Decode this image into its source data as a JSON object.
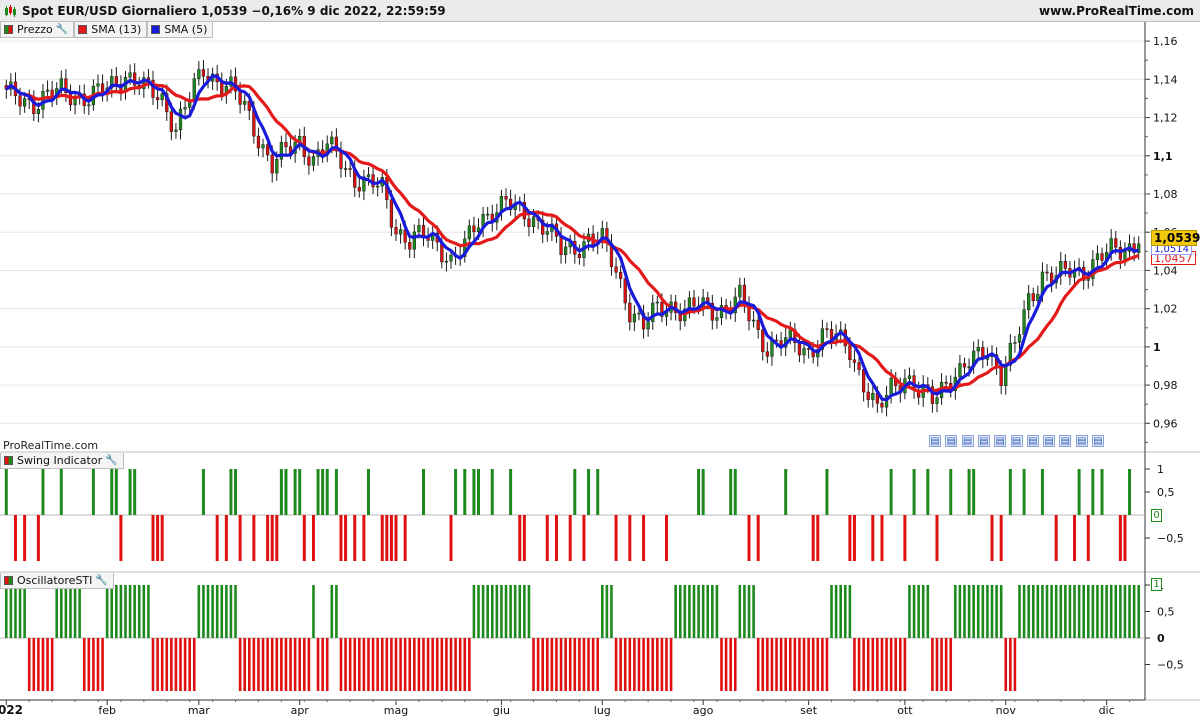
{
  "header": {
    "title": "Spot EUR/USD Giornaliero 1,0539 −0,16% 9 dic 2022, 22:59:59",
    "site": "www.ProRealTime.com"
  },
  "legend": {
    "price": "Prezzo",
    "sma13": "SMA (13)",
    "sma5": "SMA (5)"
  },
  "watermark": "ProRealTime.com",
  "badges": {
    "price": "1,0539",
    "sma5": "1,0514",
    "sma13": "1,0457",
    "swing_zero": "0",
    "osc_one": "1"
  },
  "panels": {
    "swing": "Swing Indicator",
    "osc": "OscillatoreSTI"
  },
  "icons": {
    "wrench": "wrench-icon",
    "event": "calendar-event-icon",
    "logo": "candles-logo-icon"
  },
  "colors": {
    "up": "#1e8a1e",
    "down": "#e01010",
    "sma13": "#e41a1a",
    "sma5": "#1a1adb",
    "axis": "#888888",
    "grid": "#e6e6e6"
  },
  "chart_data": [
    {
      "type": "candlestick",
      "title": "Spot EUR/USD Giornaliero",
      "ylim": [
        0.945,
        1.17
      ],
      "y_ticks": [
        {
          "v": 1.16,
          "label": "1,16"
        },
        {
          "v": 1.14,
          "label": "1,14"
        },
        {
          "v": 1.12,
          "label": "1,12"
        },
        {
          "v": 1.1,
          "label": "1,1"
        },
        {
          "v": 1.08,
          "label": "1,08"
        },
        {
          "v": 1.06,
          "label": "1,06"
        },
        {
          "v": 1.04,
          "label": "1,04"
        },
        {
          "v": 1.02,
          "label": "1,02"
        },
        {
          "v": 1.0,
          "label": "1"
        },
        {
          "v": 0.98,
          "label": "0,98"
        },
        {
          "v": 0.96,
          "label": "0,96"
        }
      ],
      "x_ticks": [
        "2022",
        "feb",
        "mar",
        "apr",
        "mag",
        "giu",
        "lug",
        "ago",
        "set",
        "ott",
        "nov",
        "dic"
      ],
      "x_tick_days": [
        0,
        22,
        42,
        64,
        85,
        108,
        130,
        152,
        175,
        196,
        218,
        240
      ],
      "last": 1.0539,
      "close_anchors": [
        [
          0,
          1.132
        ],
        [
          6,
          1.128
        ],
        [
          12,
          1.134
        ],
        [
          18,
          1.13
        ],
        [
          22,
          1.135
        ],
        [
          26,
          1.143
        ],
        [
          30,
          1.135
        ],
        [
          34,
          1.13
        ],
        [
          37,
          1.115
        ],
        [
          40,
          1.13
        ],
        [
          43,
          1.145
        ],
        [
          46,
          1.14
        ],
        [
          49,
          1.135
        ],
        [
          52,
          1.125
        ],
        [
          55,
          1.11
        ],
        [
          58,
          1.095
        ],
        [
          61,
          1.102
        ],
        [
          64,
          1.108
        ],
        [
          67,
          1.098
        ],
        [
          70,
          1.105
        ],
        [
          73,
          1.098
        ],
        [
          76,
          1.088
        ],
        [
          79,
          1.085
        ],
        [
          82,
          1.083
        ],
        [
          85,
          1.062
        ],
        [
          88,
          1.055
        ],
        [
          91,
          1.058
        ],
        [
          94,
          1.055
        ],
        [
          97,
          1.045
        ],
        [
          100,
          1.052
        ],
        [
          103,
          1.066
        ],
        [
          106,
          1.072
        ],
        [
          109,
          1.075
        ],
        [
          112,
          1.07
        ],
        [
          115,
          1.068
        ],
        [
          118,
          1.062
        ],
        [
          121,
          1.05
        ],
        [
          124,
          1.052
        ],
        [
          127,
          1.057
        ],
        [
          130,
          1.055
        ],
        [
          133,
          1.04
        ],
        [
          136,
          1.02
        ],
        [
          139,
          1.01
        ],
        [
          142,
          1.02
        ],
        [
          145,
          1.022
        ],
        [
          148,
          1.018
        ],
        [
          151,
          1.022
        ],
        [
          154,
          1.02
        ],
        [
          157,
          1.02
        ],
        [
          160,
          1.025
        ],
        [
          163,
          1.012
        ],
        [
          166,
          1.0
        ],
        [
          169,
          1.002
        ],
        [
          172,
          1.002
        ],
        [
          175,
          0.998
        ],
        [
          178,
          1.005
        ],
        [
          181,
          1.005
        ],
        [
          184,
          1.0
        ],
        [
          187,
          0.98
        ],
        [
          190,
          0.965
        ],
        [
          193,
          0.98
        ],
        [
          196,
          0.985
        ],
        [
          199,
          0.975
        ],
        [
          202,
          0.973
        ],
        [
          205,
          0.983
        ],
        [
          208,
          0.986
        ],
        [
          211,
          0.993
        ],
        [
          214,
          1.0
        ],
        [
          217,
          0.985
        ],
        [
          220,
          1.0
        ],
        [
          223,
          1.025
        ],
        [
          226,
          1.038
        ],
        [
          229,
          1.036
        ],
        [
          232,
          1.04
        ],
        [
          235,
          1.04
        ],
        [
          238,
          1.045
        ],
        [
          241,
          1.05
        ],
        [
          244,
          1.052
        ],
        [
          247,
          1.0539
        ]
      ],
      "swing_ticks": [
        {
          "v": 1,
          "label": "1"
        },
        {
          "v": 0.5,
          "label": "0,5"
        },
        {
          "v": -0.5,
          "label": "−0,5"
        }
      ],
      "osc_ticks": [
        {
          "v": 1,
          "label": "1"
        },
        {
          "v": 0.5,
          "label": "0,5"
        },
        {
          "v": 0,
          "label": "0"
        },
        {
          "v": -0.5,
          "label": "−0,5"
        }
      ],
      "series": [
        {
          "name": "SMA (13)",
          "period": 13
        },
        {
          "name": "SMA (5)",
          "period": 5
        }
      ]
    }
  ]
}
